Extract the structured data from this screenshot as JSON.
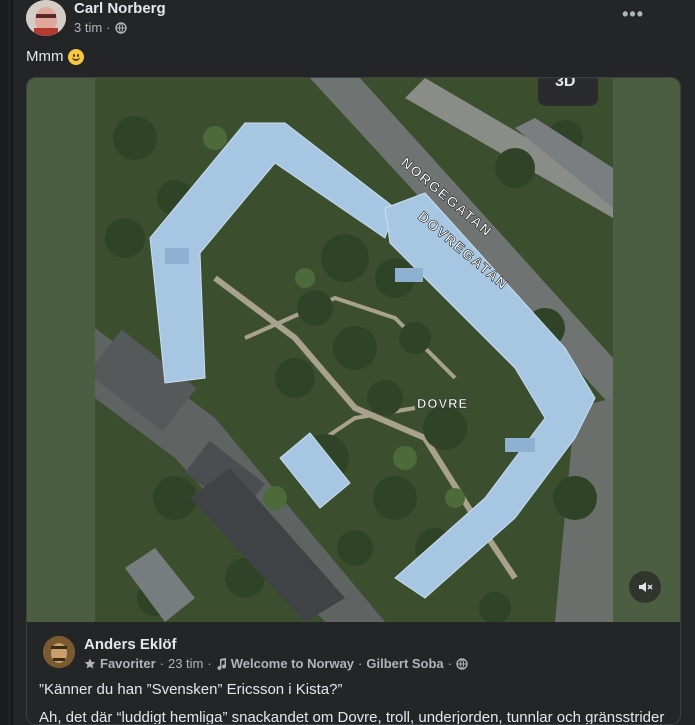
{
  "post": {
    "author": "Carl Norberg",
    "time": "3 tim",
    "separator": "·",
    "more_label": "•••",
    "text": "Mmm"
  },
  "map": {
    "street_1": "NORGEGATAN",
    "street_2": "DOVREGATAN",
    "place": "DOVRE",
    "mode_badge": "3D"
  },
  "shared_post": {
    "author": "Anders Eklöf",
    "favorites": "Favoriter",
    "time": "23 tim",
    "music": "Welcome to Norway",
    "artist": "Gilbert Soba",
    "sep": "·",
    "line1": "”Känner du han ”Svensken” Ericsson i Kista?”",
    "line2": "Ah, det där “luddigt hemliga” snackandet om Dovre, troll, underjorden, tunnlar och gränsstrider"
  },
  "colors": {
    "background": "#18191a",
    "card": "#242526",
    "media_bg": "#4b5e41",
    "building": "#a9c9e6",
    "muted_text": "#b0b3b8"
  }
}
